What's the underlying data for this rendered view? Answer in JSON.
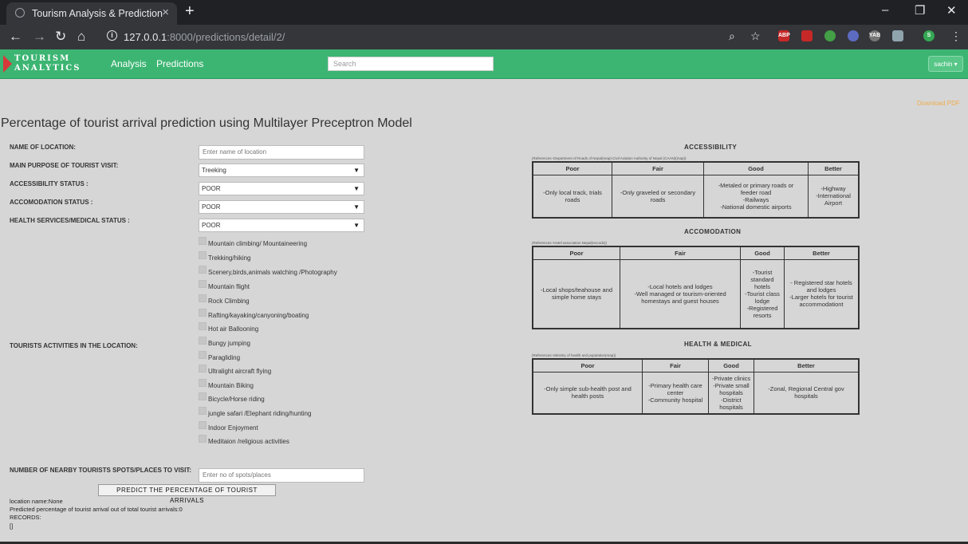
{
  "browser": {
    "tab_title": "Tourism Analysis & Prediction",
    "new_tab": "+",
    "tab_close": "×",
    "url_host": "127.0.0.1",
    "url_rest": ":8000/predictions/detail/2/",
    "ext_labels": [
      "ABP",
      "",
      "",
      "",
      "YAB",
      "",
      "S"
    ],
    "win_controls": [
      "–",
      "❐",
      "✕"
    ]
  },
  "navbar": {
    "logo_line1": "TOURISM",
    "logo_line2": "ANALYTICS",
    "links": [
      "Analysis",
      "Predictions"
    ],
    "search_placeholder": "Search",
    "user": "sachin ▾"
  },
  "page": {
    "download": "Download PDF",
    "heading": "Percentage of tourist arrival prediction using Multilayer Preceptron Model"
  },
  "form": {
    "location_label": "NAME OF LOCATION:",
    "location_placeholder": "Enter name of location",
    "purpose_label": "MAIN PURPOSE OF TOURIST VISIT:",
    "purpose_value": "Treeking",
    "access_label": "ACCESSIBILITY STATUS :",
    "access_value": "POOR",
    "accom_label": "ACCOMODATION STATUS :",
    "accom_value": "POOR",
    "health_label": "HEALTH SERVICES/MEDICAL STATUS :",
    "health_value": "POOR",
    "activities_label": "TOURISTS ACTIVITIES IN THE LOCATION:",
    "activities": [
      "Mountain climbing/ Mountaineering",
      "Trekking/hiking",
      "Scenery,birds,animals watching /Photography",
      "Mountain flight",
      "Rock Climbing",
      "Rafting/kayaking/canyoning/boating",
      "Hot air Ballooning",
      "Bungy jumping",
      "Paragliding",
      "Ultralight aircraft flying",
      "Mountain Biking",
      "Bicycle/Horse riding",
      "jungle safari /Elephant riding/hunting",
      "Indoor Enjoyment",
      "Meditaion /religious activities"
    ],
    "spots_label": "NUMBER OF NEARBY TOURISTS SPOTS/PLACES TO VISIT:",
    "spots_placeholder": "Enter no of spots/places",
    "predict_button": "PREDICT THE PERCENTAGE OF TOURIST ARRIVALS"
  },
  "result": {
    "location": "location name:None",
    "predicted": "Predicted percentage of tourist arrival out of total tourist arrivals:0",
    "records_label": "RECORDS:",
    "records_value": "[]"
  },
  "accessibility": {
    "title": "ACCESSIBILITY",
    "reference": "(References:-Department of Roads of Nepal(map)-Civil Aviation Authority of Nepal (CAAN)(map))",
    "headers": [
      "Poor",
      "Fair",
      "Good",
      "Better"
    ],
    "cells": [
      [
        "-Only local track, trials",
        "roads"
      ],
      [
        "-Only graveled or secondary",
        "roads"
      ],
      [
        "-Metaled or primary roads or",
        "feeder road",
        "-Railways",
        "-National domestic airports"
      ],
      [
        "-Highway",
        "-International",
        "Airport"
      ]
    ]
  },
  "accomodation": {
    "title": "ACCOMODATION",
    "reference": "(References:-Hotel association Nepal(records))",
    "headers": [
      "Poor",
      "Fair",
      "Good",
      "Better"
    ],
    "cells": [
      [
        "-Local shops/teahouse and",
        "simple home stays"
      ],
      [
        "-Local hotels and lodges",
        "-Well managed or tourism-oriented",
        "homestays and guest houses"
      ],
      [
        "-Tourist",
        "standard",
        "hotels",
        "-Tourist class",
        "lodge",
        "-Registered",
        "resorts"
      ],
      [
        "- Registered star hotels",
        "and lodges",
        "-Larger hotels for tourist",
        "accommodationt"
      ]
    ]
  },
  "health": {
    "title": "HEALTH & MEDICAL",
    "reference": "(References:-Ministry of health and population(map))",
    "headers": [
      "Poor",
      "Fair",
      "Good",
      "Better"
    ],
    "cells": [
      [
        "-Only simple sub-health post and",
        "health posts"
      ],
      [
        "-Primary health care",
        "center",
        "-Community hospital"
      ],
      [
        "-Private clinics",
        "-Private small",
        "hospitals",
        "-District hospitals"
      ],
      [
        "-Zonal, Regional Central gov",
        "hospitals"
      ]
    ]
  }
}
